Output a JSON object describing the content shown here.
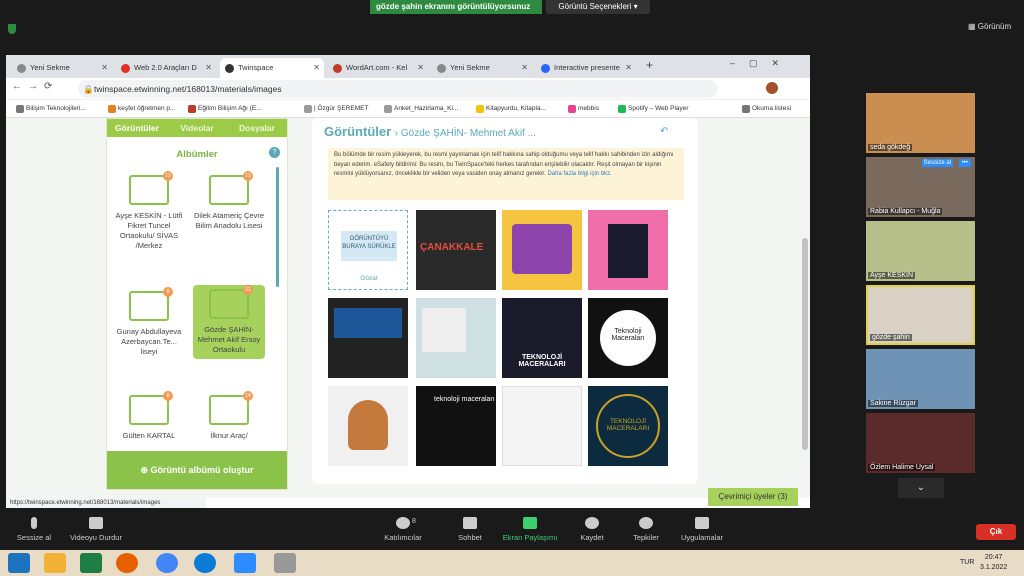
{
  "zoom": {
    "share_banner": "gözde şahin ekranını görüntülüyorsunuz",
    "view_options": "Görüntü Seçenekleri",
    "gallery_label": "Görünüm",
    "controls": [
      "Sessize al",
      "Videoyu Durdur",
      "Katılımcılar",
      "Sohbet",
      "Ekran Paylaşımı",
      "Kaydet",
      "Tepkiler",
      "Uygulamalar"
    ],
    "participant_count": "8",
    "leave_label": "Çık",
    "participants": [
      "seda gökdeğ",
      "Rabia Kullapcı - Muğla",
      "Ayşe KESKİN",
      "gözde şahin",
      "Sakine Rüzgar",
      "Özlem Halime Uysal"
    ],
    "unmute_label": "Sessize al"
  },
  "browser": {
    "tabs": [
      "Yeni Sekme",
      "Web 2.0 Araçları D",
      "Twinspace",
      "WordArt.com - Kel",
      "Yeni Sekme",
      "Interactive presente"
    ],
    "url": "twinspace.etwinning.net/168013/materials/images",
    "bookmarks": [
      "Bilişim Teknolojileri...",
      "keşfet öğretmen p...",
      "Eğitim Bilişim Ağı (E...",
      "| Özgür ŞEREMET",
      "Anket_Hazirlama_Ki...",
      "Kitapyurdu, Kitapla...",
      "mebbis",
      "Spotify – Web Player",
      "Okuma listesi"
    ],
    "status_url": "https://twinspace.etwinning.net/168013/materials/images"
  },
  "twinspace": {
    "tabs": [
      "Görüntüler",
      "Videolar",
      "Dosyalar"
    ],
    "albums_title": "Albümler",
    "albums": [
      {
        "name": "Ayşe KESKİN - Lütfi Fikret Tuncel Ortaokulu/ SİVAS /Merkez",
        "count": "12"
      },
      {
        "name": "Dilek Atameriç Çevre Bilim Anadolu Lisesi",
        "count": "13"
      },
      {
        "name": "Gunay Abdullayeva Azerbaycan.Te... liseyi",
        "count": "8"
      },
      {
        "name": "Gözde ŞAHİN-Mehmet Akif Ersoy Ortaokulu",
        "count": "11"
      },
      {
        "name": "Gülten KARTAL",
        "count": "8"
      },
      {
        "name": "İlknur Araç/",
        "count": "14"
      }
    ],
    "create_album": "Görüntü albümü oluştur",
    "images_title": "Görüntüler",
    "images_sub": "› Gözde ŞAHİN- Mehmet Akif ...",
    "notice": "Bu bölümde bir resim yükleyerek, bu resmi yayınlamak için telif hakkına sahip olduğumu veya telif hakkı sahibinden izin aldığımı beyan ederim. eSafety bildirimi: Bu resim, bu TwinSpace'teki herkes tarafından erişilebilir olacaktır. Reşit olmayan bir kişinin resmini yüklüyorsanız, önceklikle bir veliden veya vasiden onay almanız gerekir.",
    "notice_link": "Daha fazla bilgi için bkz.",
    "dropzone": "GÖRÜNTÜYÜ BURAYA SÜRÜKLE",
    "dropzone_btn": "Gözat",
    "image_texts": [
      "ÇANAKKALE",
      "TEKNOLOJİ MACERALARI",
      "Teknoloji Maceraları",
      "teknoloji maceraları",
      "TEKNOLOJİ MACERALARI"
    ],
    "online": "Çevrimiçi üyeler (3)"
  },
  "taskbar": {
    "time": "20:47",
    "date": "3.1.2022",
    "lang": "TUR"
  }
}
